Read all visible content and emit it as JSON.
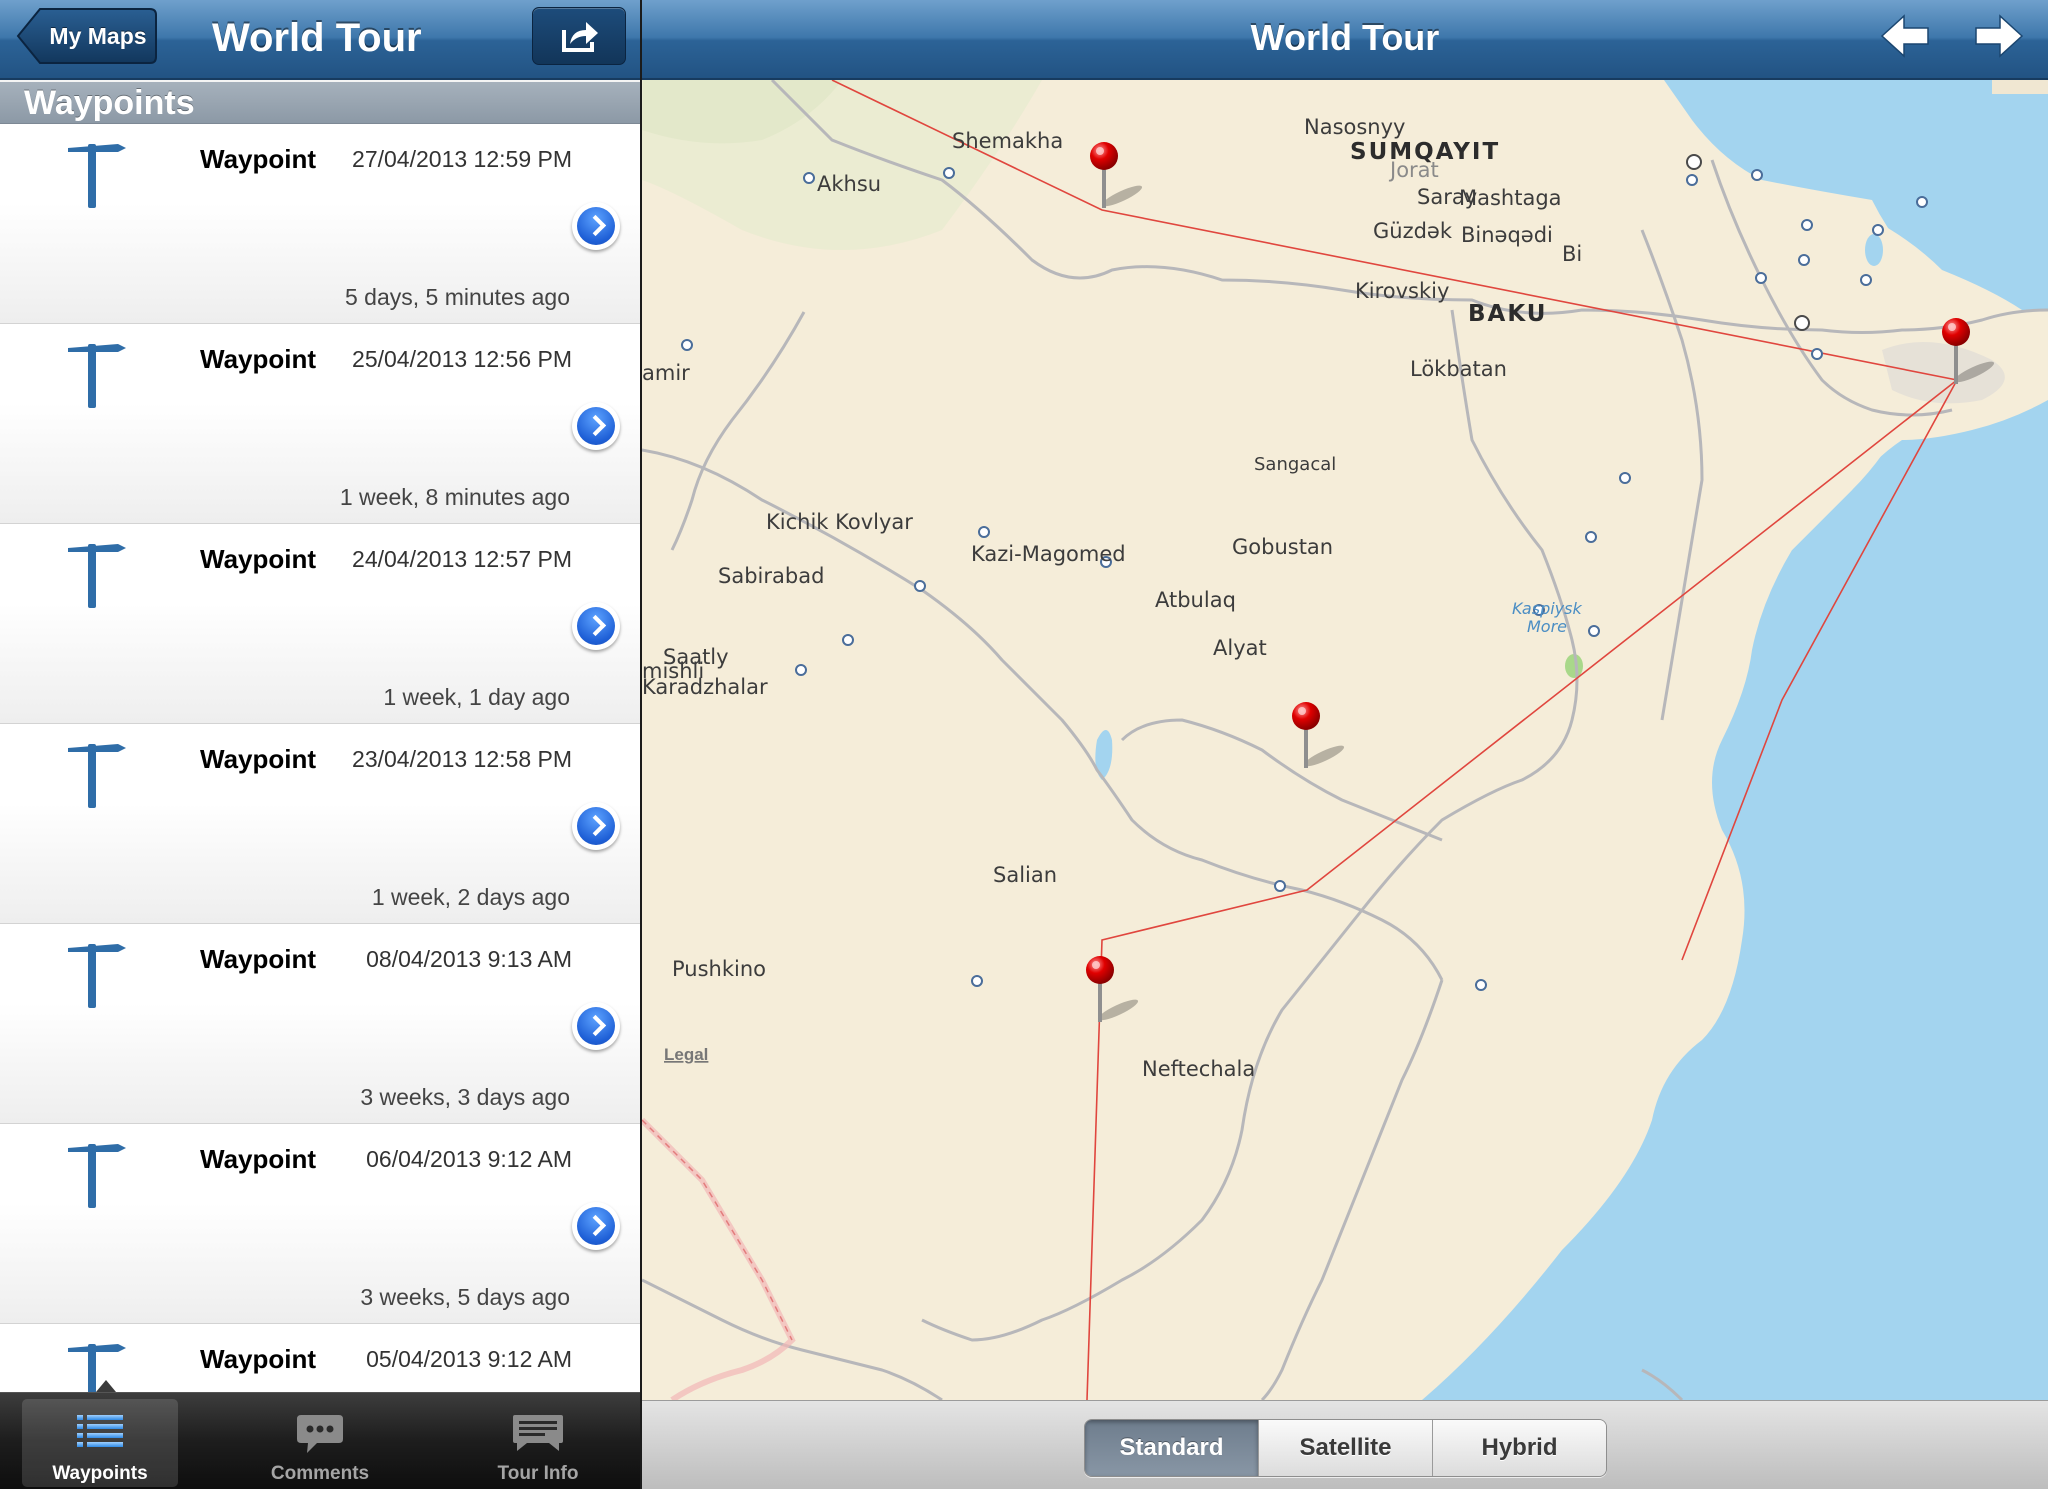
{
  "left_panel": {
    "nav": {
      "back_label": "My Maps",
      "title": "World Tour",
      "share_icon": "share-icon"
    },
    "section_title": "Waypoints",
    "waypoints": [
      {
        "name": "Waypoint",
        "datetime": "27/04/2013 12:59 PM",
        "ago": "5 days, 5 minutes ago"
      },
      {
        "name": "Waypoint",
        "datetime": "25/04/2013 12:56 PM",
        "ago": "1 week, 8 minutes ago"
      },
      {
        "name": "Waypoint",
        "datetime": "24/04/2013 12:57 PM",
        "ago": "1 week, 1 day ago"
      },
      {
        "name": "Waypoint",
        "datetime": "23/04/2013 12:58 PM",
        "ago": "1 week, 2 days ago"
      },
      {
        "name": "Waypoint",
        "datetime": "08/04/2013 9:13 AM",
        "ago": "3 weeks, 3 days ago"
      },
      {
        "name": "Waypoint",
        "datetime": "06/04/2013 9:12 AM",
        "ago": "3 weeks, 5 days ago"
      },
      {
        "name": "Waypoint",
        "datetime": "05/04/2013 9:12 AM",
        "ago": ""
      }
    ],
    "tabs": [
      {
        "label": "Waypoints",
        "icon": "list-icon",
        "active": true
      },
      {
        "label": "Comments",
        "icon": "speech-bubble-icon",
        "active": false
      },
      {
        "label": "Tour Info",
        "icon": "info-card-icon",
        "active": false
      }
    ]
  },
  "right_panel": {
    "nav": {
      "title": "World Tour",
      "prev_icon": "arrow-left-icon",
      "next_icon": "arrow-right-icon"
    },
    "map": {
      "places": [
        "Shemakha",
        "Akhsu",
        "amir",
        "Nasosnyy",
        "SUMQAYIT",
        "Jorat",
        "Saray",
        "Mashtaga",
        "Güzdək",
        "Binəqədi",
        "Bi",
        "Kirovskiy",
        "BAKU",
        "Lökbatan",
        "Sangacal",
        "Gobustan",
        "Kichik Kovlyar",
        "Kazi-Magomed",
        "Sabirabad",
        "Atbulaq",
        "Alyat",
        "Saatly",
        "Karadzhalar",
        "mishli",
        "Kaspiysk",
        "More",
        "Salian",
        "Pushkino",
        "Neftechala"
      ],
      "legal_label": "Legal",
      "colors": {
        "land": "#f5edd9",
        "water": "#a3d4ef",
        "route": "#e0463e",
        "road": "#b7b7ba"
      }
    },
    "map_types": [
      {
        "label": "Standard",
        "active": true
      },
      {
        "label": "Satellite",
        "active": false
      },
      {
        "label": "Hybrid",
        "active": false
      }
    ]
  }
}
